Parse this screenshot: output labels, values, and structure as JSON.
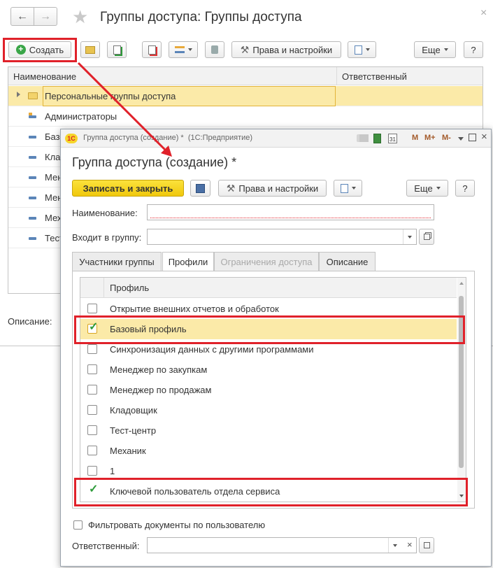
{
  "main": {
    "title": "Группы доступа: Группы доступа",
    "toolbar": {
      "create_label": "Создать",
      "rights_label": "Права и настройки",
      "more_label": "Еще",
      "help_label": "?"
    },
    "columns": [
      "Наименование",
      "Ответственный"
    ],
    "rows": [
      "Персональные группы доступа",
      "Администраторы",
      "Базо",
      "Кла",
      "Мен",
      "Мен",
      "Мех",
      "Тест"
    ],
    "description_label": "Описание:",
    "close_glyph": "×"
  },
  "dialog": {
    "window_title": "Группа доступа (создание) *  (1С:Предприятие)",
    "logo_text": "1С",
    "form_title": "Группа доступа (создание) *",
    "titlebar_buttons": [
      "M",
      "M+",
      "M-"
    ],
    "toolbar": {
      "save_close_label": "Записать и закрыть",
      "rights_label": "Права и настройки",
      "more_label": "Еще",
      "help_label": "?"
    },
    "name_label": "Наименование:",
    "name_value": "",
    "group_label": "Входит в группу:",
    "group_value": "",
    "tabs": [
      "Участники группы",
      "Профили",
      "Ограничения доступа",
      "Описание"
    ],
    "profiles_header": "Профиль",
    "profiles": [
      {
        "label": "Открытие внешних отчетов и обработок",
        "checked": false
      },
      {
        "label": "Базовый профиль",
        "checked": true
      },
      {
        "label": "Синхронизация данных с другими программами",
        "checked": false
      },
      {
        "label": "Менеджер по закупкам",
        "checked": false
      },
      {
        "label": "Менеджер по продажам",
        "checked": false
      },
      {
        "label": "Кладовщик",
        "checked": false
      },
      {
        "label": "Тест-центр",
        "checked": false
      },
      {
        "label": "Механик",
        "checked": false
      },
      {
        "label": "1",
        "checked": false
      },
      {
        "label": "Ключевой пользователь отдела сервиса",
        "checked": true
      }
    ],
    "filter_label": "Фильтровать документы по пользователю",
    "filter_checked": false,
    "responsible_label": "Ответственный:",
    "responsible_value": "",
    "clear_glyph": "×"
  },
  "colors": {
    "highlight": "#e0212a",
    "selected_row": "#fbeaa8",
    "save_button": "#f5d214",
    "check": "#2e9b3a"
  }
}
